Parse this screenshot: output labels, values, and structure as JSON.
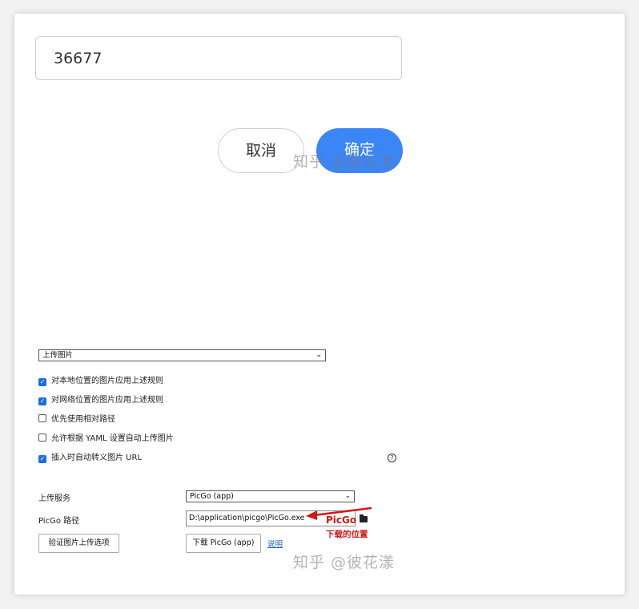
{
  "dialog": {
    "port_value": "36677",
    "cancel_label": "取消",
    "confirm_label": "确定"
  },
  "watermark": "知乎 @彼花漾",
  "settings": {
    "image_action_select": "上传图片",
    "checkboxes": [
      {
        "label": "对本地位置的图片应用上述规则",
        "checked": true
      },
      {
        "label": "对网络位置的图片应用上述规则",
        "checked": true
      },
      {
        "label": "优先使用相对路径",
        "checked": false
      },
      {
        "label": "允许根据 YAML 设置自动上传图片",
        "checked": false
      },
      {
        "label": "插入时自动转义图片 URL",
        "checked": true
      }
    ],
    "help_icon": "?",
    "upload_service_label": "上传服务",
    "upload_service_value": "PicGo (app)",
    "picgo_path_label": "PicGo 路径",
    "picgo_path_value": "D:\\application\\picgo\\PicGo.exe",
    "verify_button": "验证图片上传选项",
    "download_button": "下载 PicGo (app)",
    "docs_link": "说明"
  },
  "annotation": {
    "line1": "PicGo",
    "line2": "下载的位置",
    "color": "#d21818"
  },
  "colors": {
    "primary": "#3b86f7",
    "checkbox": "#1a6ee0"
  }
}
